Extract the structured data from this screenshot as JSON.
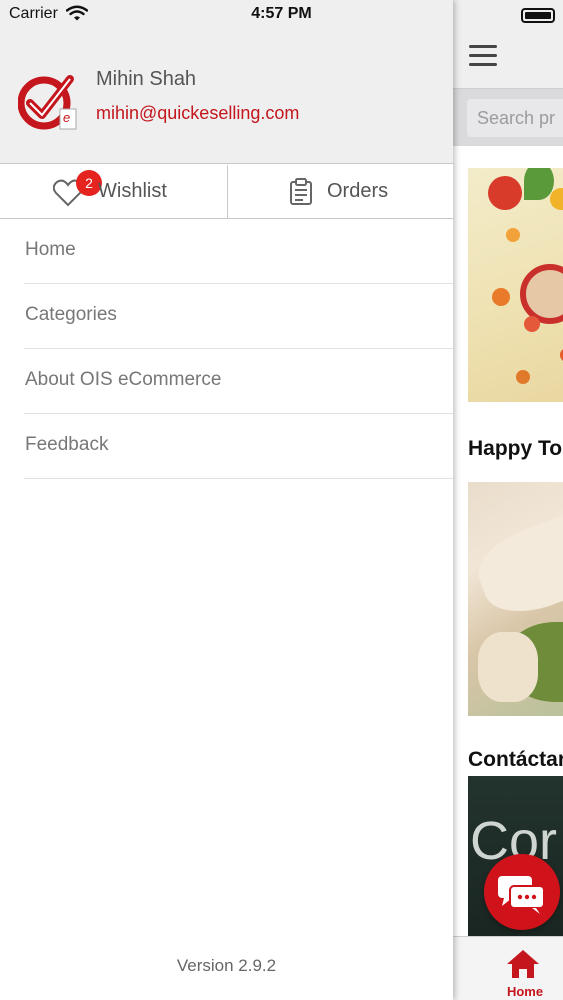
{
  "status_bar": {
    "carrier": "Carrier",
    "time": "4:57 PM"
  },
  "drawer": {
    "user": {
      "name": "Mihin Shah",
      "email": "mihin@quickeselling.com"
    },
    "quick_actions": {
      "wishlist": {
        "label": "Wishlist",
        "badge_count": "2"
      },
      "orders": {
        "label": "Orders"
      }
    },
    "menu_items": [
      {
        "label": "Home"
      },
      {
        "label": "Categories"
      },
      {
        "label": "About OIS eCommerce"
      },
      {
        "label": "Feedback"
      }
    ],
    "version": "Version 2.9.2"
  },
  "background_app": {
    "search_placeholder": "Search pr",
    "section_titles": [
      "Happy To",
      "Contáctar"
    ],
    "banner3_text": "Cor",
    "tab_home_label": "Home"
  },
  "colors": {
    "brand_red": "#c4161c",
    "badge_red": "#e5231f",
    "header_gray": "#efeff0"
  },
  "icons": [
    "wifi-icon",
    "battery-icon",
    "logo-check-icon",
    "heart-icon",
    "clipboard-icon",
    "hamburger-icon",
    "chat-icon",
    "home-icon"
  ]
}
